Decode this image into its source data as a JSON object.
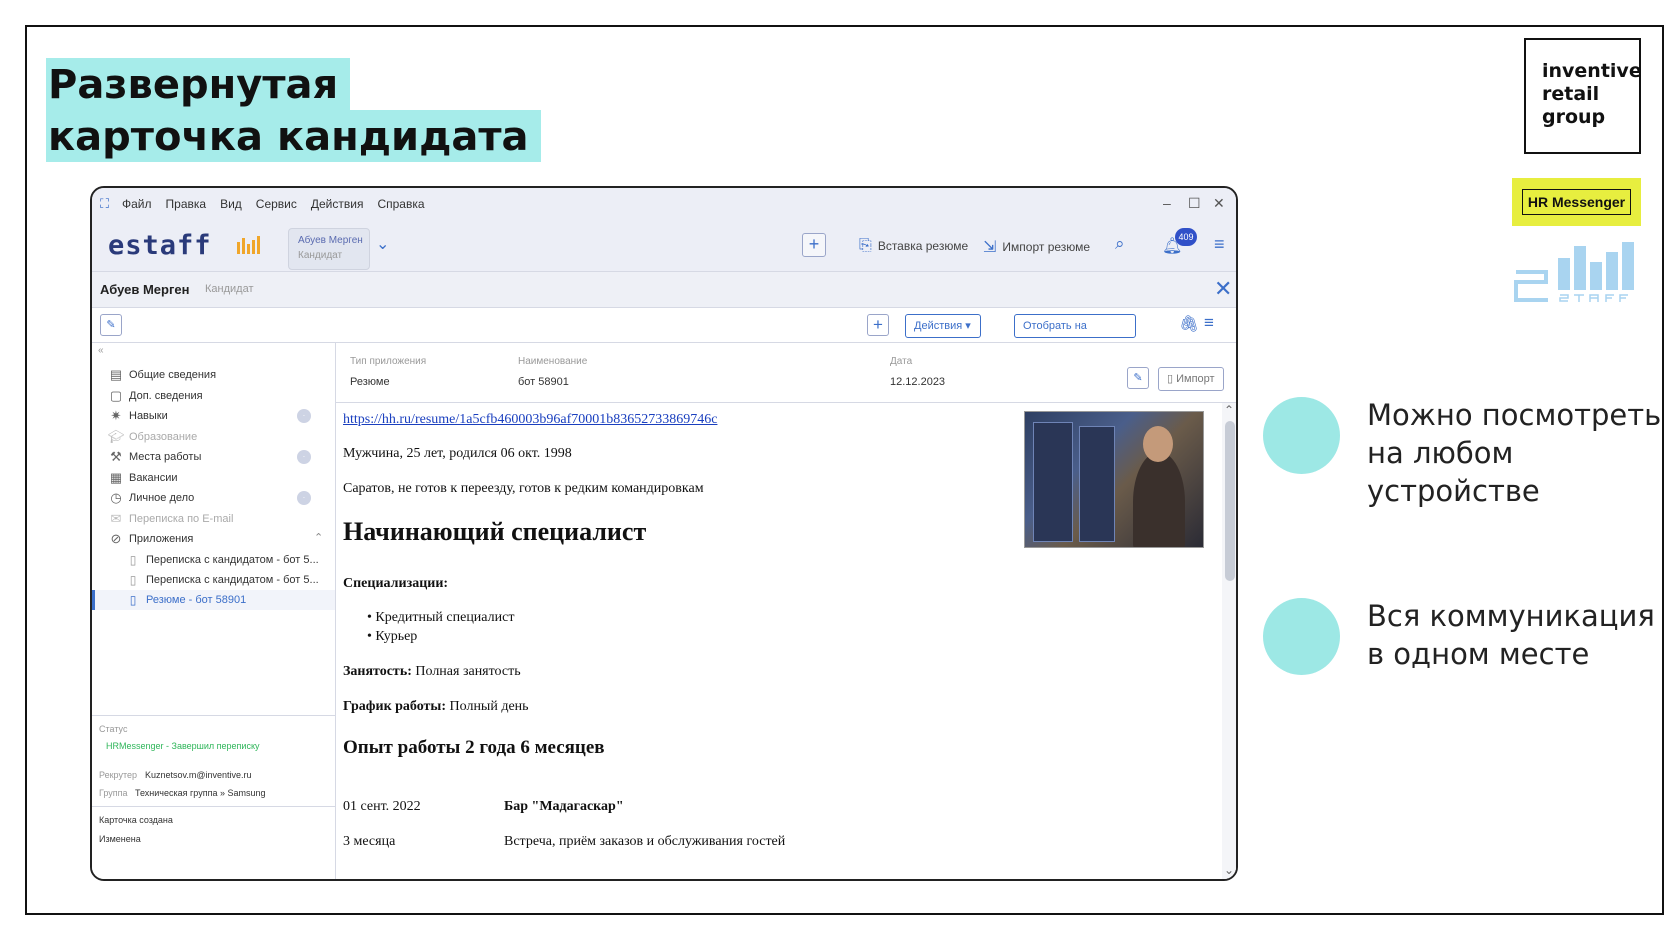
{
  "slide": {
    "title_line1": "Развернутая",
    "title_line2": "карточка кандидата",
    "logo_line1": "inventive",
    "logo_line2": "retail",
    "logo_line3": "group",
    "hr_badge": "HR Messenger",
    "bullets": [
      {
        "text": "Можно посмотреть на любом устройстве"
      },
      {
        "text": "Вся коммуникация в одном месте"
      }
    ],
    "accent_color": "#a6ecea",
    "bullet_color": "#9de8e5",
    "badge_color": "#e7ee3f"
  },
  "app": {
    "menu": [
      "Файл",
      "Правка",
      "Вид",
      "Сервис",
      "Действия",
      "Справка"
    ],
    "logo_text": "estaff",
    "recent_card": {
      "name": "Абуев Мерген",
      "role": "Кандидат"
    },
    "toolbar": {
      "insert_resume": "Вставка резюме",
      "import_resume": "Импорт резюме",
      "notification_count": "409"
    },
    "candidate": {
      "name": "Абуев Мерген",
      "role": "Кандидат"
    },
    "subbar": {
      "actions": "Действия ▾",
      "select_vacancy": "Отобрать на вакансию"
    },
    "sidebar": {
      "items": [
        {
          "label": "Общие сведения",
          "icon": "form-icon"
        },
        {
          "label": "Доп. сведения",
          "icon": "form-icon"
        },
        {
          "label": "Навыки",
          "icon": "bulb-icon"
        },
        {
          "label": "Образование",
          "icon": "cap-icon"
        },
        {
          "label": "Места работы",
          "icon": "tools-icon"
        },
        {
          "label": "Вакансии",
          "icon": "building-icon"
        },
        {
          "label": "Личное дело",
          "icon": "clock-icon"
        },
        {
          "label": "Переписка по E-mail",
          "icon": "mail-icon"
        },
        {
          "label": "Приложения",
          "icon": "paperclip-icon"
        }
      ],
      "attachments": [
        {
          "label": "Переписка с кандидатом - бот 5..."
        },
        {
          "label": "Переписка с кандидатом - бот 5..."
        },
        {
          "label": "Резюме - бот 58901"
        }
      ],
      "status_label": "Статус",
      "status_value": "HRMessenger - Завершил переписку",
      "recruiter_label": "Рекрутер",
      "recruiter_value": "Kuznetsov.m@inventive.ru",
      "group_label": "Группа",
      "group_value": "Техническая группа  »  Samsung",
      "created_label": "Карточка создана",
      "modified_label": "Изменена"
    },
    "attachment_meta": {
      "type_label": "Тип приложения",
      "type_value": "Резюме",
      "name_label": "Наименование",
      "name_value": "бот 58901",
      "date_label": "Дата",
      "date_value": "12.12.2023",
      "import_label": "Импорт"
    },
    "resume": {
      "link": "https://hh.ru/resume/1a5cfb460003b96af70001b83652733869746c",
      "personal": "Мужчина, 25 лет, родился 06 окт. 1998",
      "location": "Саратов, не готов к переезду, готов к редким командировкам",
      "position": "Начинающий специалист",
      "specializations_label": "Специализации:",
      "specializations": [
        "Кредитный специалист",
        "Курьер"
      ],
      "employment_label": "Занятость:",
      "employment_value": " Полная занятость",
      "schedule_label": "График работы:",
      "schedule_value": " Полный день",
      "experience_heading": "Опыт работы 2 года 6 месяцев",
      "job_start": "01 сент. 2022",
      "job_company": "Бар \"Мадагаскар\"",
      "job_duration": "3 месяца",
      "job_description": "Встреча, приём заказов и обслуживания гостей"
    }
  }
}
